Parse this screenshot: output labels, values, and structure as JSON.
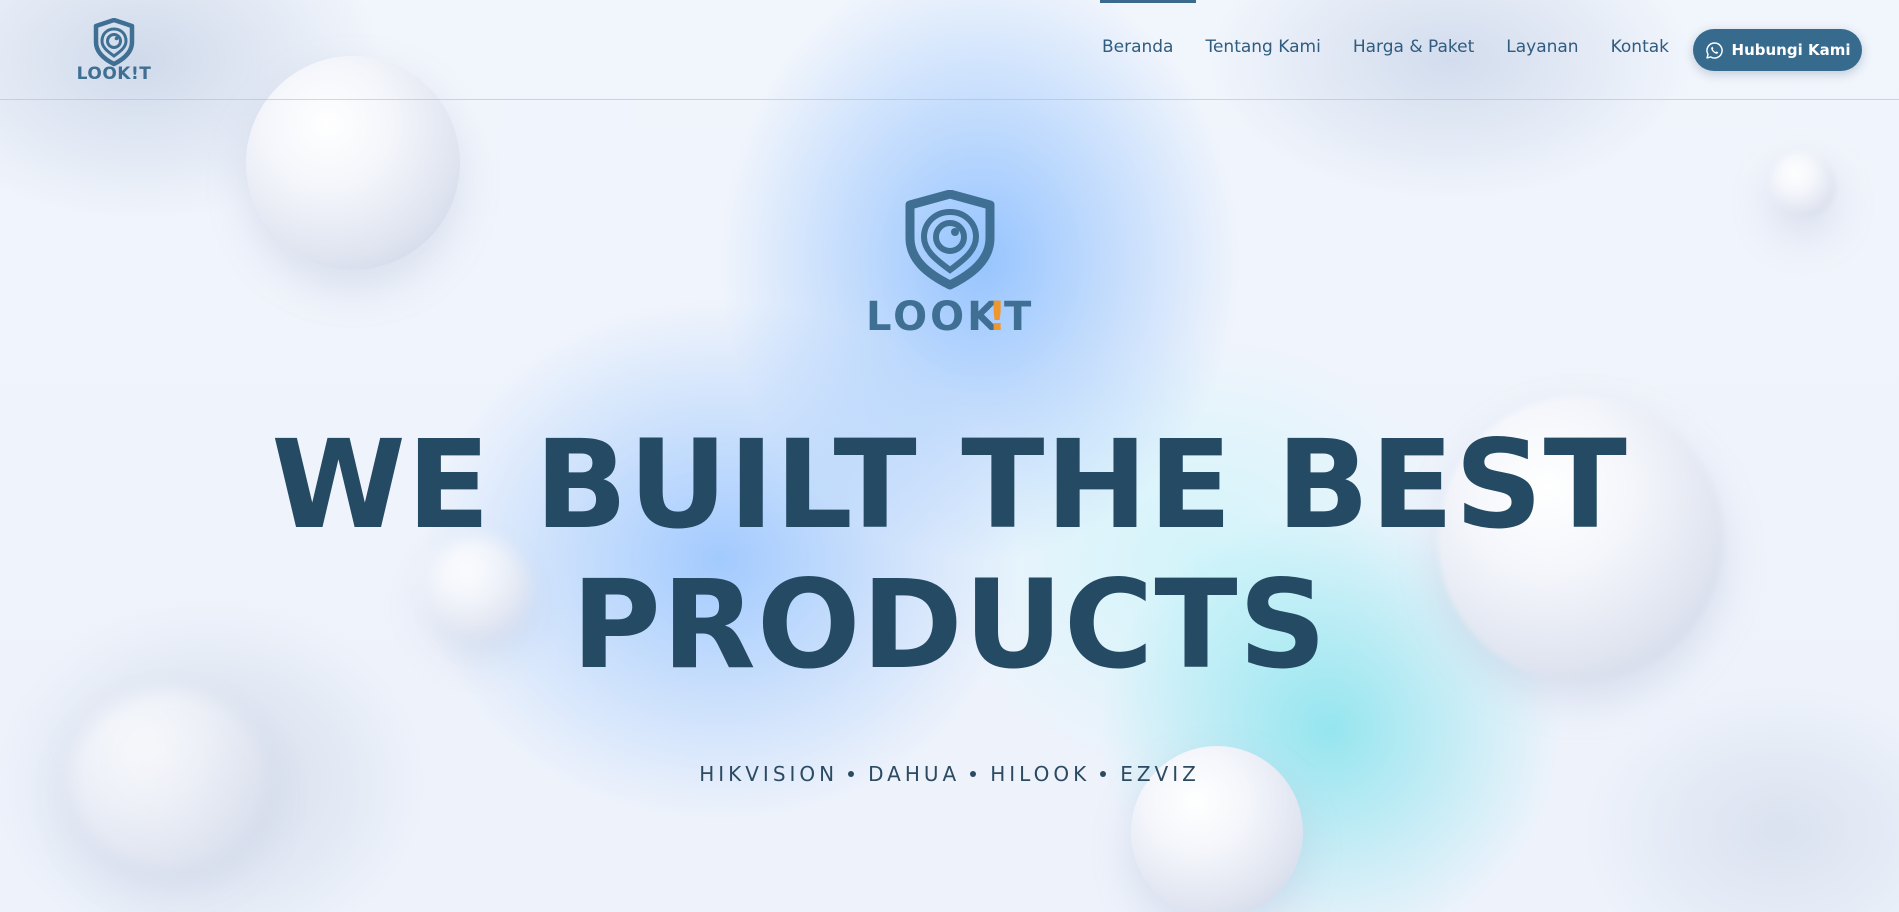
{
  "brand": {
    "name": "LOOK!T",
    "logo_text_main": "LOOK",
    "logo_text_bang": "!",
    "logo_text_end": "T",
    "primary_color": "#376b8e",
    "accent_color": "#f0962e",
    "text_color": "#254a63"
  },
  "nav": {
    "items": [
      {
        "label": "Beranda",
        "active": true
      },
      {
        "label": "Tentang Kami"
      },
      {
        "label": "Harga & Paket"
      },
      {
        "label": "Layanan"
      },
      {
        "label": "Kontak"
      }
    ],
    "cta_label": "Hubungi Kami",
    "cta_icon": "whatsapp-icon"
  },
  "hero": {
    "headline_line1": "WE BUILT THE BEST",
    "headline_line2": "PRODUCTS",
    "brands": [
      "HIKVISION",
      "DAHUA",
      "HILOOK",
      "EZVIZ"
    ]
  }
}
